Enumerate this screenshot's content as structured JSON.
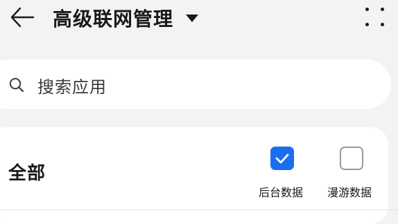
{
  "header": {
    "back_icon": "arrow-left-icon",
    "title": "高级联网管理",
    "dropdown_icon": "caret-down-icon",
    "more_icon": "four-dots-menu-icon"
  },
  "search": {
    "icon": "search-icon",
    "placeholder": "搜索应用"
  },
  "all_row": {
    "label": "全部",
    "columns": [
      {
        "label": "后台数据",
        "checked": true
      },
      {
        "label": "漫游数据",
        "checked": false
      }
    ]
  },
  "colors": {
    "accent": "#1a6ef0",
    "background": "#f1f3f5",
    "card": "#ffffff"
  }
}
